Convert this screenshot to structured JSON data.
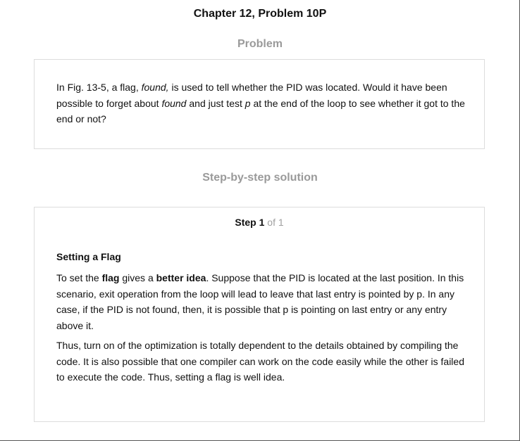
{
  "chapter_title": "Chapter 12, Problem 10P",
  "problem_heading": "Problem",
  "problem": {
    "t1": "In Fig. 13-5, a flag, ",
    "i1": "found,",
    "t2": " is used to tell whether the PID was located. Would it have been possible to forget about ",
    "i2": "found",
    "t3": " and just test ",
    "i3": "p",
    "t4": " at the end of the loop to see whether it got to the end or not?"
  },
  "solution_heading": "Step-by-step solution",
  "step": {
    "word": "Step",
    "number": "1",
    "of_total": "of 1"
  },
  "solution": {
    "title": "Setting a Flag",
    "p1_a": "To set the ",
    "p1_b": "flag",
    "p1_c": " gives a ",
    "p1_d": "better idea",
    "p1_e": ". Suppose that the PID is located at the last position. In this scenario, exit operation from the loop will lead to leave that last entry is pointed by p. In any case, if the PID is not found, then, it is possible that p is pointing on last entry or any entry above it.",
    "p2": "Thus, turn on of the optimization is totally dependent to the details obtained by compiling the code. It is also possible that one compiler can work on the code easily while the other is failed to execute the code. Thus, setting a flag is well idea."
  }
}
